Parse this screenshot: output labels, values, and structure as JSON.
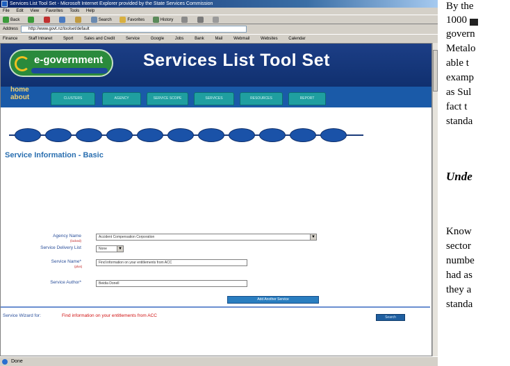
{
  "browser": {
    "title": "Services List Tool Set - Microsoft Internet Explorer provided by the State Services Commission",
    "menu": [
      "File",
      "Edit",
      "View",
      "Favorites",
      "Tools",
      "Help"
    ],
    "toolbar": [
      "Back",
      "Forward",
      "Stop",
      "Refresh",
      "Home",
      "Search",
      "Favorites",
      "History",
      "Mail",
      "Print",
      "Edit"
    ],
    "address_label": "Address",
    "address_value": "http://www.govt.nz/toolset/default",
    "links": [
      "Finance",
      "Staff Intranet",
      "Sport",
      "Sales and Credit",
      "Service",
      "Google",
      "Jobs",
      "Bank",
      "Mail",
      "Webmail",
      "Websites",
      "Calendar"
    ],
    "status": "Done"
  },
  "header": {
    "logo_text": "e-government",
    "site_title": "Services List Tool Set"
  },
  "nav": {
    "home": "home",
    "about": "about",
    "tabs": [
      "CLUSTERS",
      "AGENCY",
      "SERVICE SCOPE",
      "SERVICES",
      "RESOURCES",
      "REPORT"
    ]
  },
  "form": {
    "heading": "Service Information - Basic",
    "agency_label": "Agency Name",
    "agency_hint": "(locked)",
    "agency_value": "Accident Compensation Corporation",
    "delivery_label": "Service Delivery List",
    "delivery_value": "None",
    "service_name_label": "Service Name*",
    "service_name_hint": "(plus)",
    "service_name_value": "Find information on your entitlements from ACC",
    "author_label": "Service Author*",
    "author_value": "Beidia Donell",
    "add_button": "Add Another Service",
    "wizard_label": "Service Wizard for:",
    "wizard_value": "Find information on your entitlements from ACC",
    "search_button": "Search"
  },
  "doc": {
    "lines": [
      "By the",
      "1000",
      "govern",
      "Metalo",
      "able t",
      "examp",
      "as Sul",
      "fact t",
      "standa"
    ],
    "heading": "Unde",
    "lines2": [
      "Know",
      "sector",
      "numbe",
      "had as",
      "they a",
      "standa"
    ]
  }
}
